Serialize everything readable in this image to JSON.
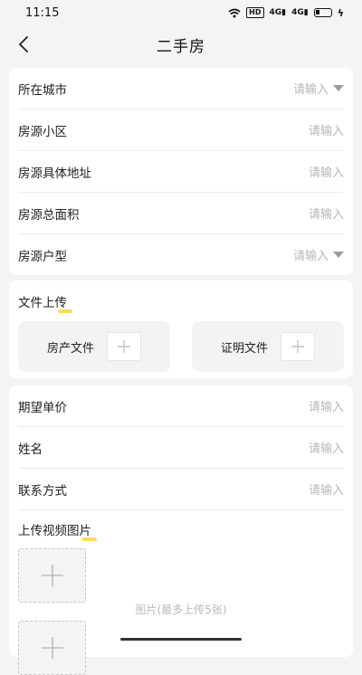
{
  "status_bar": {
    "time": "11:15",
    "hd": "HD",
    "signal_1": "4G",
    "signal_2": "4G"
  },
  "header": {
    "title": "二手房"
  },
  "basic_info": {
    "rows": [
      {
        "label": "所在城市",
        "placeholder": "请输入",
        "dropdown": true
      },
      {
        "label": "房源小区",
        "placeholder": "请输入",
        "dropdown": false
      },
      {
        "label": "房源具体地址",
        "placeholder": "请输入",
        "dropdown": false
      },
      {
        "label": "房源总面积",
        "placeholder": "请输入",
        "dropdown": false
      },
      {
        "label": "房源户型",
        "placeholder": "请输入",
        "dropdown": true
      }
    ]
  },
  "file_upload": {
    "title": "文件上传",
    "items": [
      {
        "label": "房产文件"
      },
      {
        "label": "证明文件"
      }
    ]
  },
  "extra_info": {
    "rows": [
      {
        "label": "期望单价",
        "placeholder": "请输入"
      },
      {
        "label": "姓名",
        "placeholder": "请输入"
      },
      {
        "label": "联系方式",
        "placeholder": "请输入"
      }
    ],
    "media_title": "上传视频图片",
    "media_hint": "图片(最多上传5张)"
  },
  "colors": {
    "background": "#f4f4f6",
    "card": "#ffffff",
    "placeholder": "#b6b6b6",
    "highlight": "#f4d94a"
  }
}
